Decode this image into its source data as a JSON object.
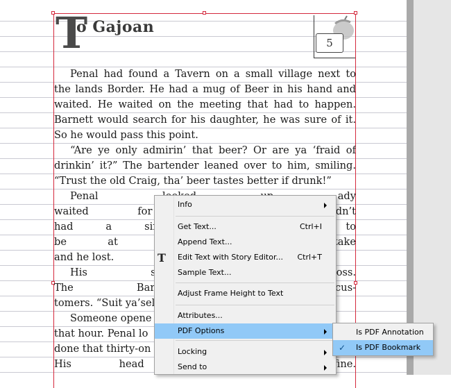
{
  "page": {
    "drop_cap": "T",
    "title_rest": "o Gajoan",
    "chapter_number": "5"
  },
  "story_lines": [
    {
      "text": "Penal had found a Tavern on a small village next to",
      "indent": true,
      "last": false
    },
    {
      "text": "the lands Border. He had a mug of Beer in his hand and",
      "indent": false,
      "last": false
    },
    {
      "text": "waited. He waited on the meeting that had to happen.",
      "indent": false,
      "last": false
    },
    {
      "text": "Barnett would search for his daughter, he was sure of it.",
      "indent": false,
      "last": false
    },
    {
      "text": "So he would pass this point.",
      "indent": false,
      "last": true
    },
    {
      "text": "“Are ye only admirin’ that beer? Or are ya ‘fraid of",
      "indent": true,
      "last": false
    },
    {
      "text": "drinkin’ it?” The bartender leaned over to him, smiling.",
      "indent": false,
      "last": false
    },
    {
      "text": "“Trust the old Craig, tha’ beer tastes better if drunk!”",
      "indent": false,
      "last": true
    },
    {
      "text": "Penal looked up                                   ady",
      "indent": true,
      "last": false
    },
    {
      "text": "waited for an hour                                  dn’t",
      "indent": false,
      "last": false
    },
    {
      "text": "had a single drop. T                                  d to",
      "indent": false,
      "last": false
    },
    {
      "text": "be at his best for                                   take",
      "indent": false,
      "last": false
    },
    {
      "text": "and he lost.",
      "indent": false,
      "last": true
    },
    {
      "text": "His stare seeme                                   oss.",
      "indent": true,
      "last": false
    },
    {
      "text": "The Bartender shri                                  cus-",
      "indent": false,
      "last": false
    },
    {
      "text": "tomers. “Suit ya’sel",
      "indent": false,
      "last": true
    },
    {
      "text": "Someone opene",
      "indent": true,
      "last": true
    },
    {
      "text": "that hour. Penal lo",
      "indent": false,
      "last": true
    },
    {
      "text": "done that thirty-on",
      "indent": false,
      "last": true
    },
    {
      "text": "His head was bruis                                    fine.",
      "indent": false,
      "last": false
    }
  ],
  "context_menu": {
    "items": [
      {
        "label": "Info",
        "shortcut": "",
        "submenu": true
      },
      {
        "label": "Get Text...",
        "shortcut": "Ctrl+I",
        "submenu": false
      },
      {
        "label": "Append Text...",
        "shortcut": "",
        "submenu": false
      },
      {
        "label": "Edit Text with Story Editor...",
        "shortcut": "Ctrl+T",
        "submenu": false,
        "icon": "story-editor-icon"
      },
      {
        "label": "Sample Text...",
        "shortcut": "",
        "submenu": false
      },
      {
        "label": "Adjust Frame Height to Text",
        "shortcut": "",
        "submenu": false
      },
      {
        "label": "Attributes...",
        "shortcut": "",
        "submenu": false
      },
      {
        "label": "PDF Options",
        "shortcut": "",
        "submenu": true,
        "highlighted": true
      },
      {
        "label": "Locking",
        "shortcut": "",
        "submenu": true
      },
      {
        "label": "Send to",
        "shortcut": "",
        "submenu": true
      }
    ],
    "story_icon_glyph": "T"
  },
  "pdf_submenu": {
    "items": [
      {
        "label": "Is PDF Annotation",
        "checked": false
      },
      {
        "label": "Is PDF Bookmark",
        "checked": true,
        "highlighted": true
      }
    ],
    "check_glyph": "✓"
  },
  "colors": {
    "frame": "#d4283c",
    "highlight": "#91c9f7",
    "menu_bg": "#f0f0f0"
  }
}
